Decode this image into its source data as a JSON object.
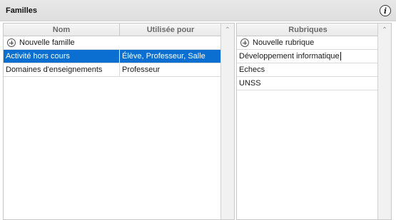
{
  "header": {
    "title": "Familles",
    "info_icon": "info-icon"
  },
  "families": {
    "columns": [
      "Nom",
      "Utilisée pour"
    ],
    "add_label": "Nouvelle famille",
    "rows": [
      {
        "nom": "Activité hors cours",
        "used_for": "Élève, Professeur, Salle",
        "selected": true
      },
      {
        "nom": "Domaines d'enseignements",
        "used_for": "Professeur",
        "selected": false
      }
    ]
  },
  "rubriques": {
    "column": "Rubriques",
    "add_label": "Nouvelle rubrique",
    "rows": [
      {
        "label": "Développement informatique",
        "editing": true
      },
      {
        "label": "Echecs",
        "editing": false
      },
      {
        "label": "UNSS",
        "editing": false
      }
    ]
  },
  "colors": {
    "selection": "#0a6fd0",
    "titlebar": "#e2e2e2",
    "header_text": "#6b6b6b"
  }
}
